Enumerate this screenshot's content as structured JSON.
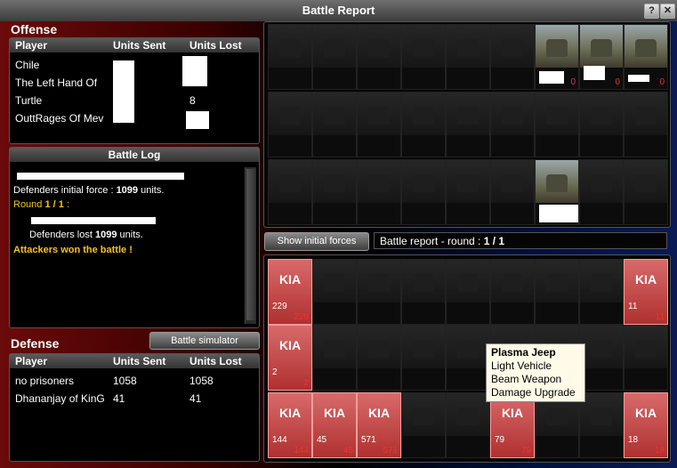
{
  "window": {
    "title": "Battle Report",
    "help_label": "?",
    "close_label": "✕"
  },
  "offense": {
    "header": "Offense",
    "columns": [
      "Player",
      "Units Sent",
      "Units Lost"
    ],
    "rows": [
      {
        "player": "Chile",
        "sent": "",
        "lost": ""
      },
      {
        "player": "The Left Hand Of",
        "sent": "",
        "lost": ""
      },
      {
        "player": "Turtle",
        "sent": "",
        "lost": "8"
      },
      {
        "player": "OuttRages Of Mev",
        "sent": "",
        "lost": ""
      }
    ]
  },
  "battle_log": {
    "title": "Battle Log",
    "defenders_initial_prefix": "Defenders initial force : ",
    "defenders_initial_value": "1099",
    "defenders_initial_suffix": " units.",
    "round_prefix": "Round ",
    "round_value": "1 / 1",
    "round_suffix": " :",
    "defenders_lost_prefix": "Defenders lost ",
    "defenders_lost_value": "1099",
    "defenders_lost_suffix": " units.",
    "result": "Attackers won the battle !"
  },
  "defense": {
    "header": "Defense",
    "simulator_button": "Battle simulator",
    "columns": [
      "Player",
      "Units Sent",
      "Units Lost"
    ],
    "rows": [
      {
        "player": "no prisoners",
        "sent": "1058",
        "lost": "1058"
      },
      {
        "player": "Dhananjay of KinG",
        "sent": "41",
        "lost": "41"
      }
    ]
  },
  "controls": {
    "show_initial_forces": "Show initial forces",
    "report_round_prefix": "Battle report - round : ",
    "report_round_value": "1 / 1"
  },
  "attacker_grid": {
    "lit_zeros": [
      "0",
      "0",
      "0"
    ]
  },
  "defender_grid": {
    "kia_label": "KIA",
    "kia_cards": [
      {
        "count": "229",
        "lost": "229"
      },
      {
        "count": "11",
        "lost": "11"
      },
      {
        "count": "2",
        "lost": "2"
      },
      {
        "count": "144",
        "lost": "144"
      },
      {
        "count": "45",
        "lost": "45"
      },
      {
        "count": "571",
        "lost": "571"
      },
      {
        "count": "79",
        "lost": "79"
      },
      {
        "count": "18",
        "lost": "18"
      }
    ]
  },
  "tooltip": {
    "name": "Plasma Jeep",
    "line1": "Light Vehicle",
    "line2": "Beam Weapon",
    "line3": "Damage Upgrade"
  },
  "colors": {
    "round_yellow": "#f2c31b",
    "result_yellow": "#f2c31b",
    "kia_red": "#c04040"
  }
}
